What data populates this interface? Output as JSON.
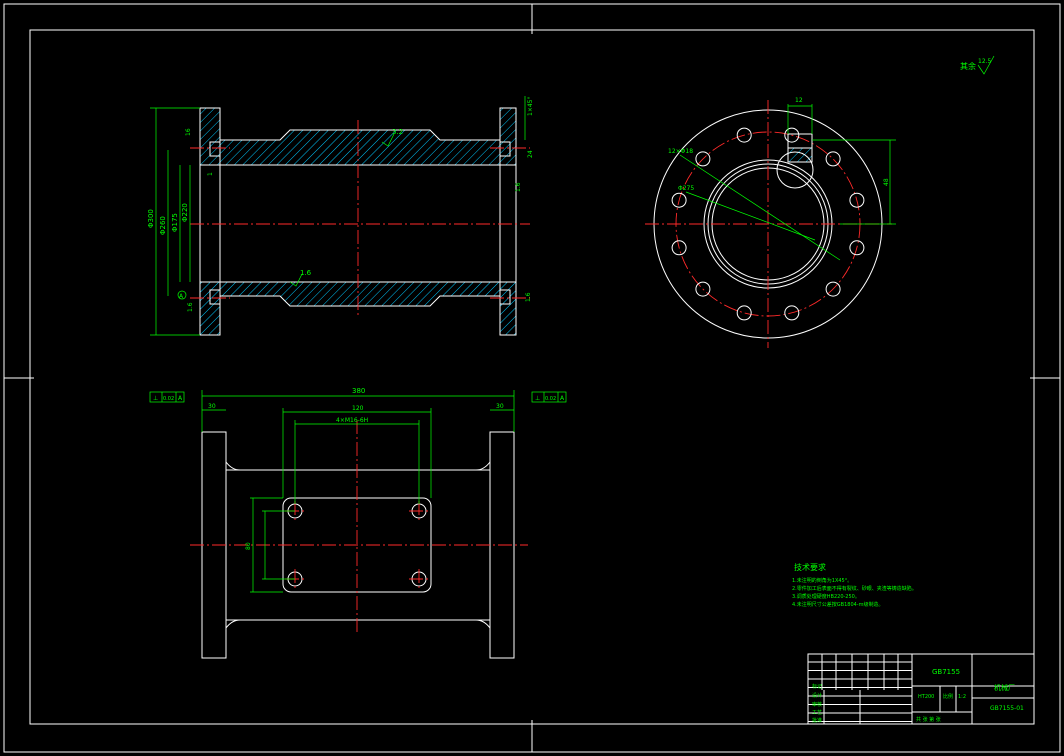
{
  "drawing": {
    "roughness_label": "其余",
    "roughness_value": "12.5",
    "tech_req_title": "技术要求",
    "tech_req_items": [
      "1.未注明的倒角为1X45°。",
      "2.零件加工后表面不得有裂纹、砂眼、夹渣等铸造缺陷。",
      "3.调质处理硬度HB220-250。",
      "4.未注明尺寸公差按GB1804-m级制造。"
    ]
  },
  "front_view": {
    "dims": {
      "d_overall": "Φ300",
      "d_flange": "Φ260",
      "d_bore": "Φ175",
      "d_body": "Φ220",
      "roughness_top": "3.2",
      "roughness_bottom": "1.6",
      "chamfer_right": "1×45°",
      "w_right_top": "24",
      "w_right_mid": "1.6",
      "w_left_top": "16",
      "note_left_top": "1",
      "note_right_bot": "1.6",
      "note_left_bot": "1.6",
      "datum": "A"
    }
  },
  "end_view": {
    "dims": {
      "slot_w": "12",
      "slot_h": "48",
      "holes_label": "12×Φ18",
      "pcd_label": "Φ275"
    }
  },
  "top_view": {
    "dims": {
      "overall": "380",
      "flange_left": "30",
      "flange_right": "30",
      "hole_span": "120",
      "hole_span_inner": "4×M16-6H",
      "hole_height": "80",
      "tol_left_1": "⊥",
      "tol_left_2": "0.02",
      "tol_left_3": "A",
      "tol_right_1": "⊥",
      "tol_right_2": "0.02",
      "tol_right_3": "A"
    }
  },
  "title_block": {
    "part_name": "GB7155",
    "company": "机械厂",
    "drawing_no": "GB7155-01",
    "material": "HT200",
    "scale_label": "比例",
    "scale": "1:2",
    "rows": [
      "标记",
      "设计",
      "审核",
      "工艺",
      "批准"
    ],
    "sheet": "共  张  第  张"
  }
}
